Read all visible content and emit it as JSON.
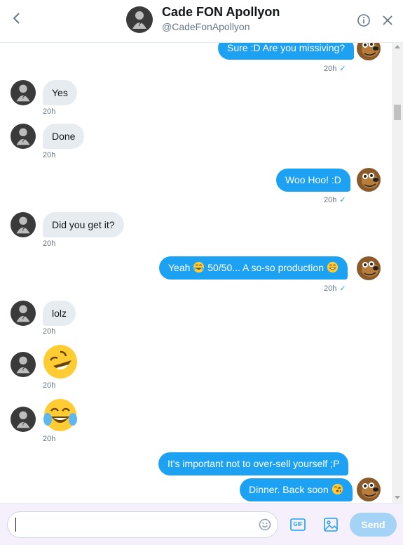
{
  "header": {
    "back_label": "‹",
    "name": "Cade FON Apollyon",
    "handle": "@CadeFonApollyon"
  },
  "colors": {
    "accent": "#1da1f2",
    "incoming_bubble": "#e6ecf0",
    "composer_bg": "#f5f0fb",
    "send_disabled": "#a4d3f5"
  },
  "messages": [
    {
      "dir": "out",
      "text": "Sure :D Are you missiving?",
      "time": "20h",
      "read": "✓"
    },
    {
      "dir": "in",
      "text": "Yes",
      "time": "20h"
    },
    {
      "dir": "in",
      "text": "Done",
      "time": "20h"
    },
    {
      "dir": "out",
      "text": "Woo Hoo! :D",
      "time": "20h",
      "read": "✓"
    },
    {
      "dir": "in",
      "text": "Did you get it?",
      "time": "20h"
    },
    {
      "dir": "out",
      "text_before": "Yeah",
      "text_after": "50/50... A so-so production",
      "emoji_1": "tears-of-joy-emoji",
      "emoji_2": "grinning-emoji",
      "time": "20h",
      "read": "✓"
    },
    {
      "dir": "in",
      "text": "lolz",
      "time": "20h"
    },
    {
      "dir": "in",
      "emoji": "rolling-on-floor-laughing-emoji",
      "time": "20h"
    },
    {
      "dir": "in",
      "emoji": "tears-of-joy-emoji",
      "time": "20h"
    },
    {
      "dir": "out",
      "text": "It's important not to over-sell yourself ;P"
    },
    {
      "dir": "out",
      "text": "Dinner. Back soon",
      "emoji": "kissing-emoji"
    }
  ],
  "composer": {
    "placeholder": "",
    "gif_label": "GIF",
    "send_label": "Send"
  }
}
